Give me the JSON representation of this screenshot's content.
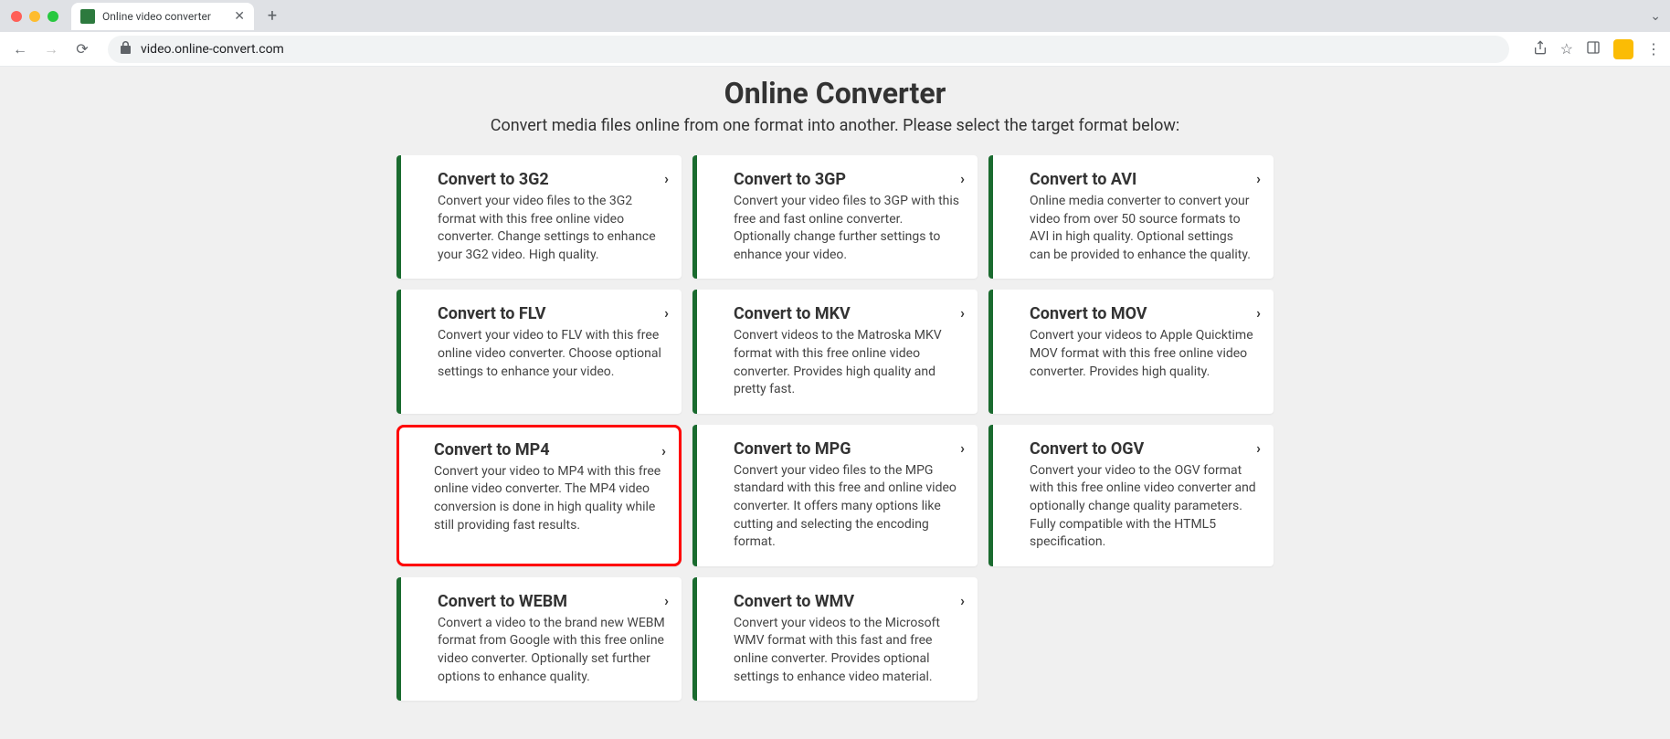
{
  "browser": {
    "tab_title": "Online video converter",
    "url": "video.online-convert.com"
  },
  "page": {
    "title": "Online Converter",
    "subtitle": "Convert media files online from one format into another. Please select the target format below:"
  },
  "cards": [
    {
      "id": "3g2",
      "title": "Convert to 3G2",
      "desc": "Convert your video files to the 3G2 format with this free online video converter. Change settings to enhance your 3G2 video. High quality.",
      "highlighted": false
    },
    {
      "id": "3gp",
      "title": "Convert to 3GP",
      "desc": "Convert your video files to 3GP with this free and fast online converter. Optionally change further settings to enhance your video.",
      "highlighted": false
    },
    {
      "id": "avi",
      "title": "Convert to AVI",
      "desc": "Online media converter to convert your video from over 50 source formats to AVI in high quality. Optional settings can be provided to enhance the quality.",
      "highlighted": false
    },
    {
      "id": "flv",
      "title": "Convert to FLV",
      "desc": "Convert your video to FLV with this free online video converter. Choose optional settings to enhance your video.",
      "highlighted": false
    },
    {
      "id": "mkv",
      "title": "Convert to MKV",
      "desc": "Convert videos to the Matroska MKV format with this free online video converter. Provides high quality and pretty fast.",
      "highlighted": false
    },
    {
      "id": "mov",
      "title": "Convert to MOV",
      "desc": "Convert your videos to Apple Quicktime MOV format with this free online video converter. Provides high quality.",
      "highlighted": false
    },
    {
      "id": "mp4",
      "title": "Convert to MP4",
      "desc": "Convert your video to MP4 with this free online video converter. The MP4 video conversion is done in high quality while still providing fast results.",
      "highlighted": true
    },
    {
      "id": "mpg",
      "title": "Convert to MPG",
      "desc": "Convert your video files to the MPG standard with this free and online video converter. It offers many options like cutting and selecting the encoding format.",
      "highlighted": false
    },
    {
      "id": "ogv",
      "title": "Convert to OGV",
      "desc": "Convert your video to the OGV format with this free online video converter and optionally change quality parameters. Fully compatible with the HTML5 specification.",
      "highlighted": false
    },
    {
      "id": "webm",
      "title": "Convert to WEBM",
      "desc": "Convert a video to the brand new WEBM format from Google with this free online video converter. Optionally set further options to enhance quality.",
      "highlighted": false
    },
    {
      "id": "wmv",
      "title": "Convert to WMV",
      "desc": "Convert your videos to the Microsoft WMV format with this fast and free online converter. Provides optional settings to enhance video material.",
      "highlighted": false
    }
  ]
}
